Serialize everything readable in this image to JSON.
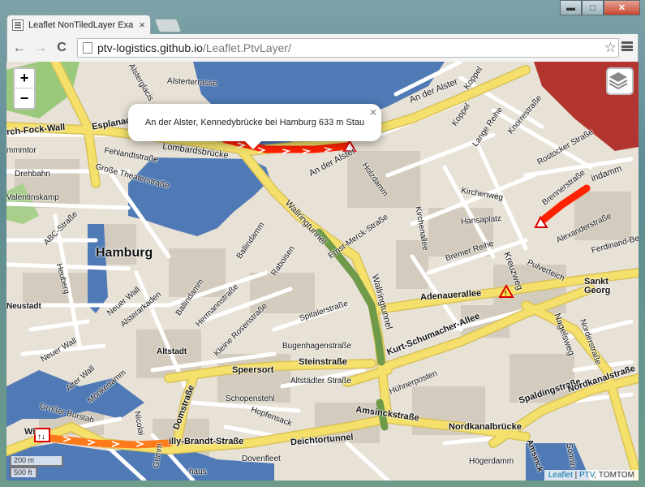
{
  "browser": {
    "tab_title": "Leaflet NonTiledLayer Exa",
    "tab_close": "×",
    "url_host": "ptv-logistics.github.io",
    "url_path": "/Leaflet.PtvLayer/",
    "back_glyph": "←",
    "forward_glyph": "→",
    "reload_glyph": "C",
    "star_glyph": "☆",
    "window_controls": {
      "minimize": "▬",
      "maximize": "□",
      "close": "✕"
    }
  },
  "map": {
    "zoom_in": "+",
    "zoom_out": "−",
    "popup": {
      "text": "An der Alster, Kennedybrücke bei Hamburg 633 m Stau",
      "close": "×"
    },
    "scale": {
      "metric": "200 m",
      "imperial": "500 ft"
    },
    "attribution": {
      "leaflet": "Leaflet",
      "sep": " | ",
      "ptv": "PTV",
      "rest": ", TOMTOM"
    },
    "labels": {
      "alsterterrasse": "Alsterterrasse",
      "an_der_alster_top": "An der Alster",
      "koppel": "Koppel",
      "lange_reihe": "Lange Reihe",
      "knorrestrasse": "Knorrestraße",
      "koppel2": "Koppel",
      "alsterglacis": "Alsterglacis",
      "esplanade": "Esplanade",
      "rch_fock_wall": "rch-Fock-Wall",
      "mammtor": "mmmtor",
      "lombardsbruecke": "Lombardsbrücke",
      "fehlandtstrasse": "Fehlandtstraße",
      "grosse_theaterstrasse": "Große Theaterstraße",
      "drehbahn": "Drehbahn",
      "valentinskamp": "Valentinskamp",
      "an_der_alster": "An der Alster",
      "holzdamm": "Holzdamm",
      "kirchenweg": "Kirchenweg",
      "hansaplatz": "Hansaplatz",
      "rostocker_strasse": "Rostocker Straße",
      "brennerstrasse": "Brennerstraße",
      "stindamm": "indamm",
      "wallringtunnel": "Wallringtunnel",
      "ernst_merck": "Ernst-Merck-Straße",
      "kirchenallee": "Kirchenallee",
      "bremer_reihe": "Bremer Reihe",
      "alexanderstrasse": "Alexanderstraße",
      "ferdinand": "Ferdinand-Beit-S",
      "hamburg": "Hamburg",
      "abc_strasse": "ABC-Straße",
      "ballindamm": "Ballindamm",
      "raboisen": "Raboisen",
      "kreuzweg": "Kreuzweg",
      "pulverteich": "Pulverteich",
      "sankt_georg": "Sankt Georg",
      "heuberg": "Heuberg",
      "neuer_wall": "Neuer Wall",
      "alsterarkaden": "Alsterarkaden",
      "hermannstrasse": "Hermannstraße",
      "kleine_rosenstrasse": "Kleine Rosenstraße",
      "ballindamm2": "Ballindamm",
      "spitalerstrasse": "Spitalerstraße",
      "wallringtunnel2": "Wallringtunnel",
      "adenauerallee": "Adenauerallee",
      "neustadt": "Neustadt",
      "kurt_schumacher": "Kurt-Schumacher-Allee",
      "nagelsweg": "Nagelsweg",
      "norderstrasse": "Norderstraße",
      "altstadt": "Altstadt",
      "bugenhagenstrasse": "Bugenhagenstraße",
      "steinstrasse": "Steinstraße",
      "neuer_wall2": "Neuer Wall",
      "speersort": "Speersort",
      "altstaedter": "Altstädter Straße",
      "huehnerposten": "Hühnerposten",
      "spaldingstrasse": "Spaldingstraße",
      "nordkanalstrasse": "Nordkanalstraße",
      "alter_wall": "Alter Wall",
      "moenkedamm": "Mönkedamm",
      "domstrasse": "Domstraße",
      "schopenstehl": "Schopenstehl",
      "hopfensack": "Hopfensack",
      "grosser_burstah": "Großer Burstah",
      "amsinckstrasse": "Amsinckstraße",
      "nordkanalbruecke": "Nordkanalbrücke",
      "wi": "Wi",
      "willy_brandt": "illy-Brandt-Straße",
      "deichtortunnel": "Deichtortunnel",
      "hoegerdamm": "Högerdamm",
      "dovenfleet": "Dovenfleet",
      "haus": "haus",
      "grimm": "Grimm",
      "nikolai": "Nicolai",
      "amsinck2": "Amsinck",
      "sonnin": "Sonnin"
    }
  },
  "colors": {
    "water": "#4f7ab5",
    "road_major": "#f5e06b",
    "road_minor": "#ffffff",
    "traffic_jam": "#ff2200",
    "traffic_slow": "#ff7a1a",
    "tunnel": "#6f9a4a",
    "building": "#cfc7b9",
    "red_zone": "#b2352f",
    "park": "#9bc97c"
  }
}
